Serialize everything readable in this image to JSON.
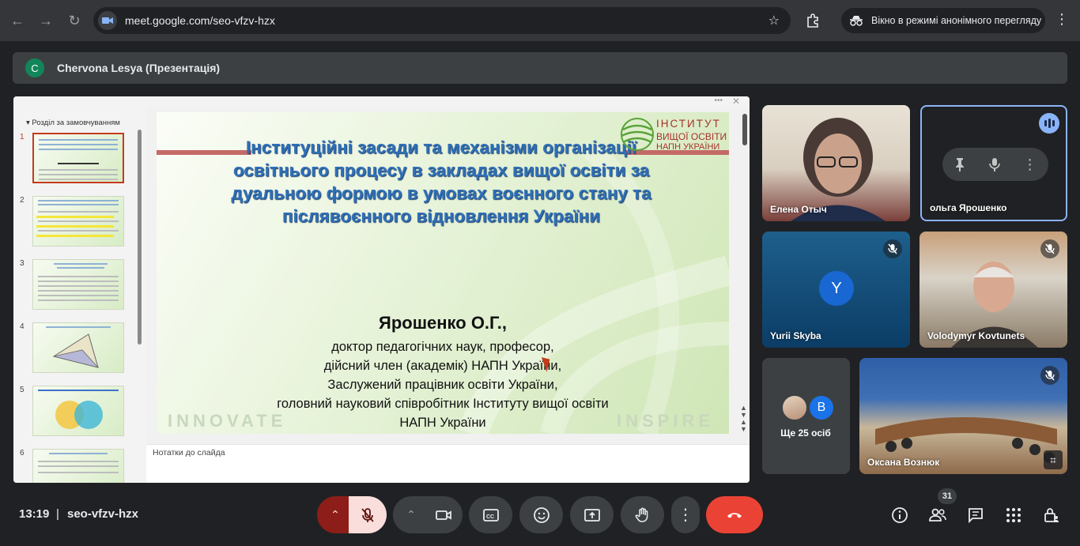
{
  "browser": {
    "url": "meet.google.com/seo-vfzv-hzx",
    "incognito_label": "Вікно в режимі анонімного перегляду"
  },
  "presenter": {
    "initial": "C",
    "name": "Chervona Lesya (Презентація)"
  },
  "slides_panel": {
    "section_label": "Розділ за замовчуванням",
    "thumbnails": [
      "1",
      "2",
      "3",
      "4",
      "5",
      "6"
    ],
    "selected": "1"
  },
  "slide": {
    "title_lines": [
      "Інституційні засади та механізми організації",
      "освітнього процесу в закладах вищої освіти за",
      "дуальною формою в умовах воєнного стану та",
      "післявоєнного відновлення України"
    ],
    "logo_line1": "ІНСТИТУТ",
    "logo_line2": "ВИЩОЇ ОСВІТИ",
    "logo_line3": "НАПН УКРАЇНИ",
    "author": "Ярошенко О.Г.,",
    "author_lines": [
      "доктор педагогічних наук,  професор,",
      "дійсний член (академік) НАПН України,",
      "Заслужений працівник освіти України,",
      "головний науковий співробітник  Інституту вищої освіти",
      "НАПН України"
    ],
    "watermark_left": "INNOVATE",
    "watermark_right": "INSPIRE"
  },
  "notes_placeholder": "Нотатки до слайда",
  "participants": [
    {
      "name": "Елена Отыч",
      "muted": false
    },
    {
      "name": "ольга Ярошенко",
      "speaking": true
    },
    {
      "name": "Yurii Skyba",
      "initial": "Y",
      "muted": true
    },
    {
      "name": "Volodymyr Kovtunets",
      "muted": true
    },
    {
      "name": "Оксана Вознюк",
      "muted": true
    }
  ],
  "more_participants": {
    "initial": "B",
    "label": "Ще 25 осіб"
  },
  "bottom_bar": {
    "time": "13:19",
    "separator": "|",
    "meeting_code": "seo-vfzv-hzx",
    "participant_count": "31"
  },
  "colors": {
    "end_call": "#ea4335",
    "mic_muted_bg": "#f9dedc",
    "mic_arrow_bg": "#8c1d18",
    "speaking": "#8ab4f8"
  }
}
